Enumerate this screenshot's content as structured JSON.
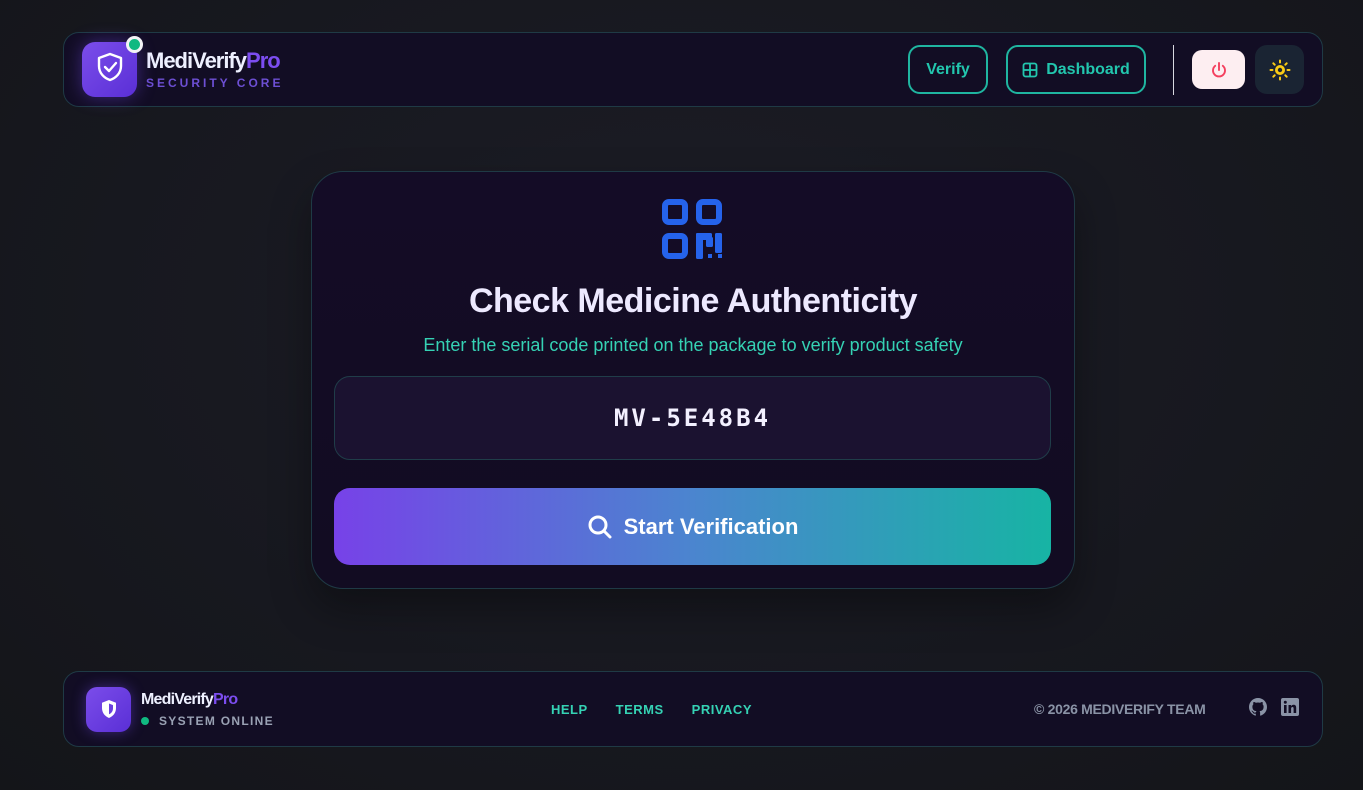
{
  "header": {
    "brand_name": "MediVerify",
    "brand_suffix": "Pro",
    "brand_tagline": "SECURITY CORE",
    "nav_verify_label": "Verify",
    "nav_dashboard_label": "Dashboard"
  },
  "card": {
    "icon": "qr-code-icon",
    "title": "Check Medicine Authenticity",
    "subtitle": "Enter the serial code printed on the package to verify product safety",
    "serial_value": "MV-5E48B4",
    "submit_label": "Start Verification"
  },
  "footer": {
    "brand_name": "MediVerify",
    "brand_suffix": "Pro",
    "status_text": "SYSTEM ONLINE",
    "links": [
      "HELP",
      "TERMS",
      "PRIVACY"
    ],
    "copyright": "© 2026 MEDIVERIFY TEAM"
  },
  "colors": {
    "accent_teal": "#22c6ae",
    "accent_purple": "#7c4df0",
    "status_green": "#10b981",
    "qr_blue": "#2563eb"
  }
}
